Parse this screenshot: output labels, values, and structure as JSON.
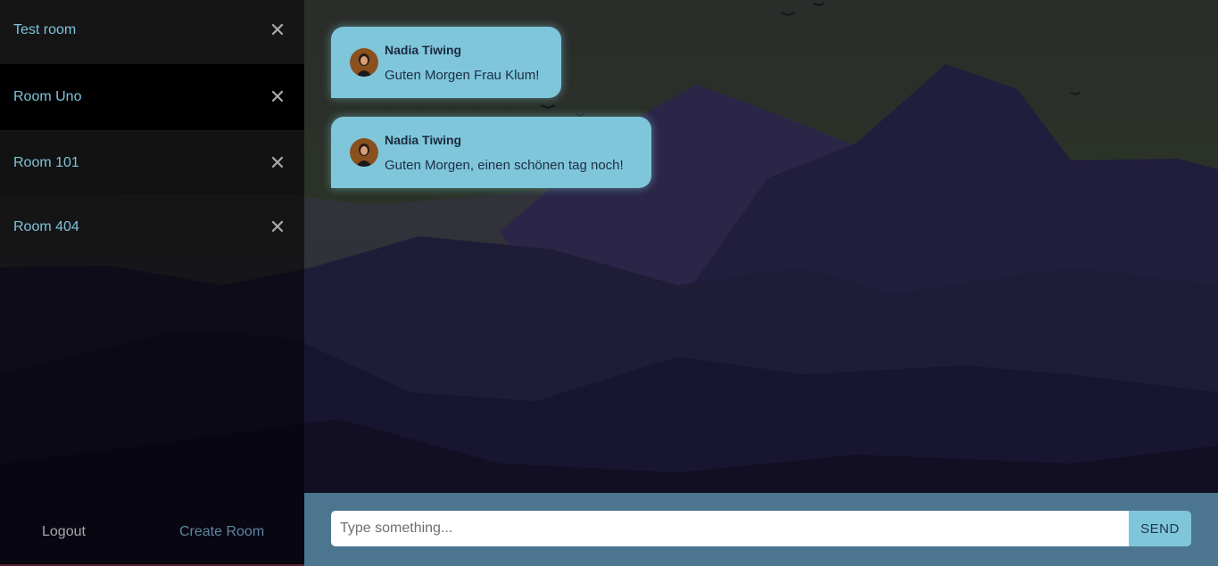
{
  "sidebar": {
    "rooms": [
      {
        "label": "Test room",
        "close_icon": "close-icon"
      },
      {
        "label": "Room Uno",
        "close_icon": "close-icon"
      },
      {
        "label": "Room 101",
        "close_icon": "close-icon"
      },
      {
        "label": "Room 404",
        "close_icon": "close-icon"
      }
    ],
    "close_glyph": "✕",
    "logout_label": "Logout",
    "create_room_label": "Create Room"
  },
  "messages": [
    {
      "sender": "Nadia Tiwing",
      "text": "Guten Morgen Frau Klum!",
      "avatar_icon": "user-avatar"
    },
    {
      "sender": "Nadia Tiwing",
      "text": "Guten Morgen, einen schönen tag noch!",
      "avatar_icon": "user-avatar"
    }
  ],
  "composer": {
    "placeholder": "Type something...",
    "value": "",
    "send_label": "SEND"
  },
  "colors": {
    "accent": "#7fc6da",
    "input_bar": "#4c7590",
    "room_label": "#7fc3dc",
    "create_room": "#5d85a5"
  }
}
